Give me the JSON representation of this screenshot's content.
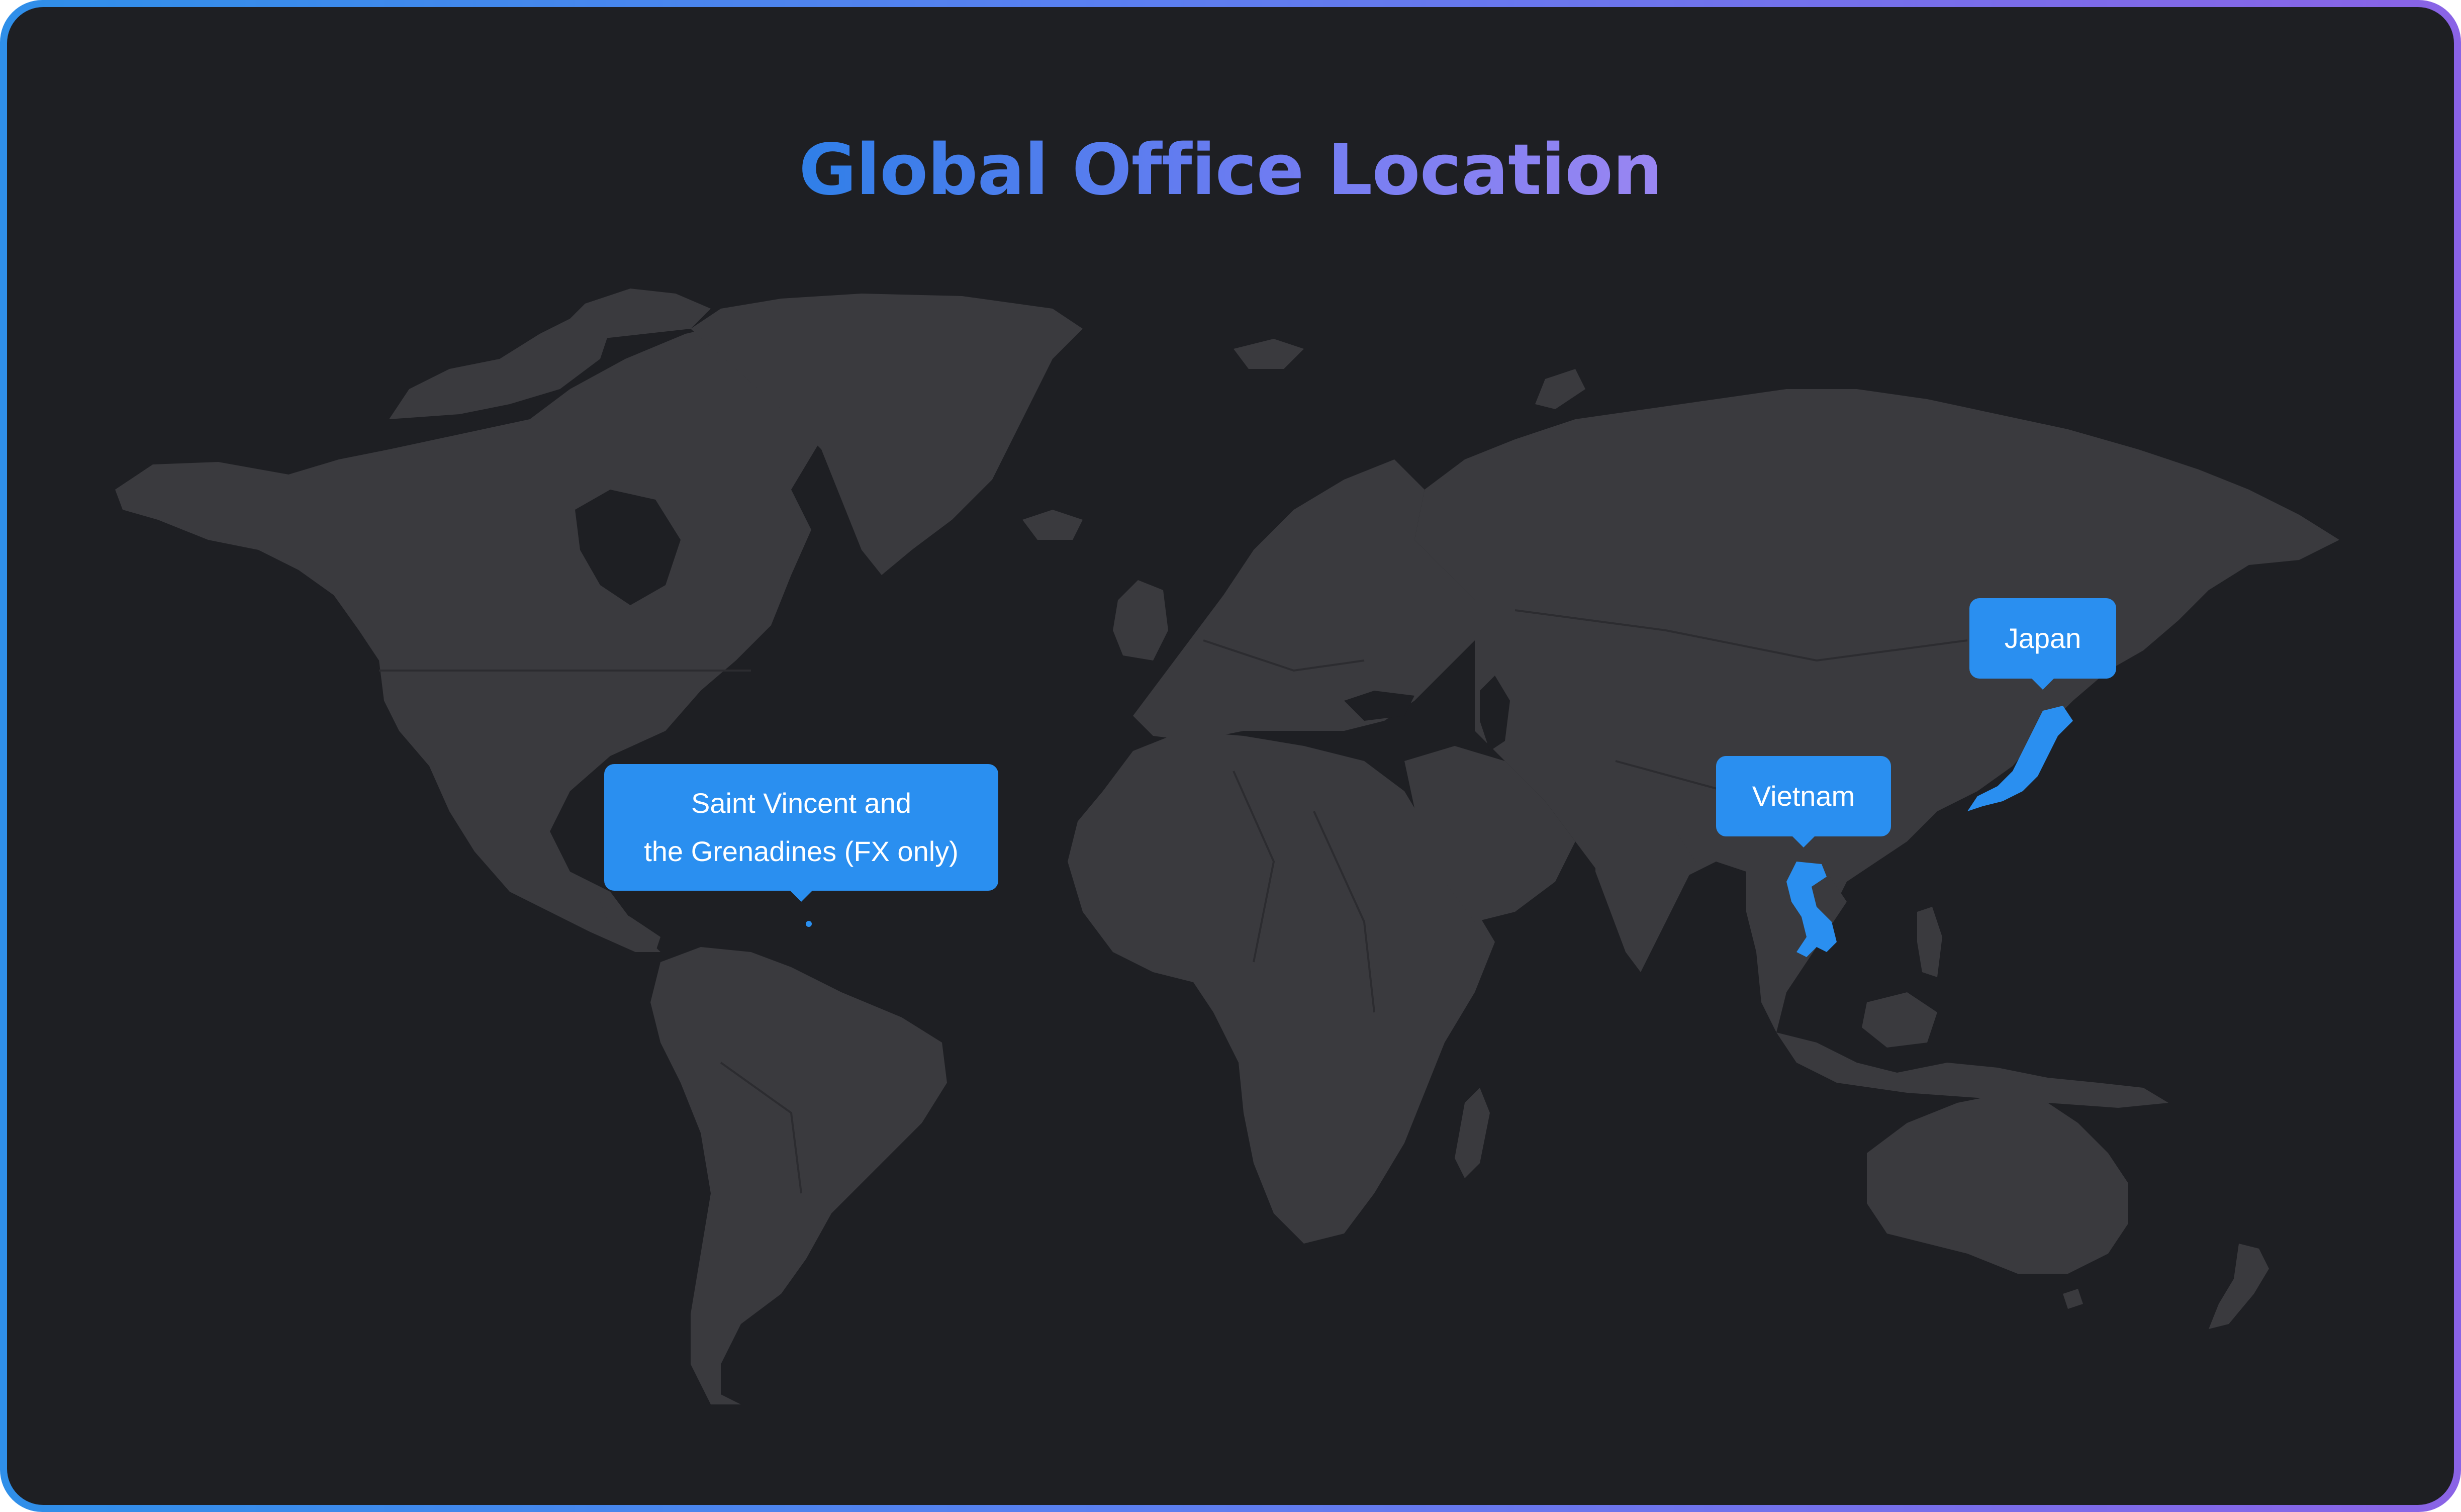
{
  "title": "Global Office Location",
  "map": {
    "land_color": "#3a3a3e",
    "background_color": "#1e1f23",
    "highlight_color": "#2a8ff0",
    "highlighted_countries": [
      "Saint Vincent and the Grenadines",
      "Vietnam",
      "Japan"
    ]
  },
  "locations": [
    {
      "label_line1": "Saint Vincent and",
      "label_line2": "the Grenadines (FX only)"
    },
    {
      "label": "Vietnam"
    },
    {
      "label": "Japan"
    }
  ]
}
